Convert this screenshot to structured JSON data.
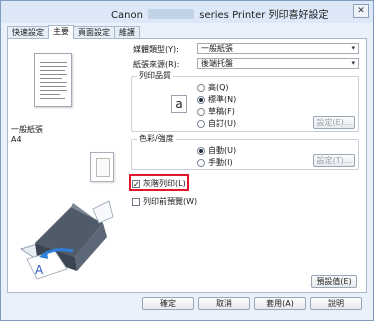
{
  "window": {
    "title_prefix": "Canon",
    "title_suffix": "series Printer 列印喜好設定",
    "close_glyph": "✕"
  },
  "tabs": [
    {
      "label": "快速設定",
      "active": false
    },
    {
      "label": "主要",
      "active": true
    },
    {
      "label": "頁面設定",
      "active": false
    },
    {
      "label": "維護",
      "active": false
    }
  ],
  "preview": {
    "media_name": "一般紙張",
    "media_size": "A4"
  },
  "main": {
    "media_type_label": "媒體類型(Y):",
    "media_type_value": "一般紙張",
    "paper_source_label": "紙張來源(R):",
    "paper_source_value": "後端托盤",
    "print_quality": {
      "title": "列印品質",
      "options": [
        {
          "label": "高(Q)",
          "selected": false
        },
        {
          "label": "標準(N)",
          "selected": true
        },
        {
          "label": "草稿(F)",
          "selected": false
        },
        {
          "label": "自訂(U)",
          "selected": false
        }
      ],
      "settings_button": "設定(E)..."
    },
    "color_intensity": {
      "title": "色彩/強度",
      "options": [
        {
          "label": "自動(U)",
          "selected": true
        },
        {
          "label": "手動(I)",
          "selected": false
        }
      ],
      "settings_button": "設定(T)..."
    },
    "grayscale_label": "灰階列印(L)",
    "grayscale_checked": true,
    "preview_label": "列印前預覽(W)",
    "preview_checked": false,
    "defaults_button": "預設值(E)"
  },
  "footer": {
    "ok": "確定",
    "cancel": "取消",
    "apply": "套用(A)",
    "help": "說明"
  },
  "colors": {
    "highlight": "#e0182d",
    "window_bg": "#eaf1fb"
  },
  "icons": {
    "quality": "a"
  }
}
